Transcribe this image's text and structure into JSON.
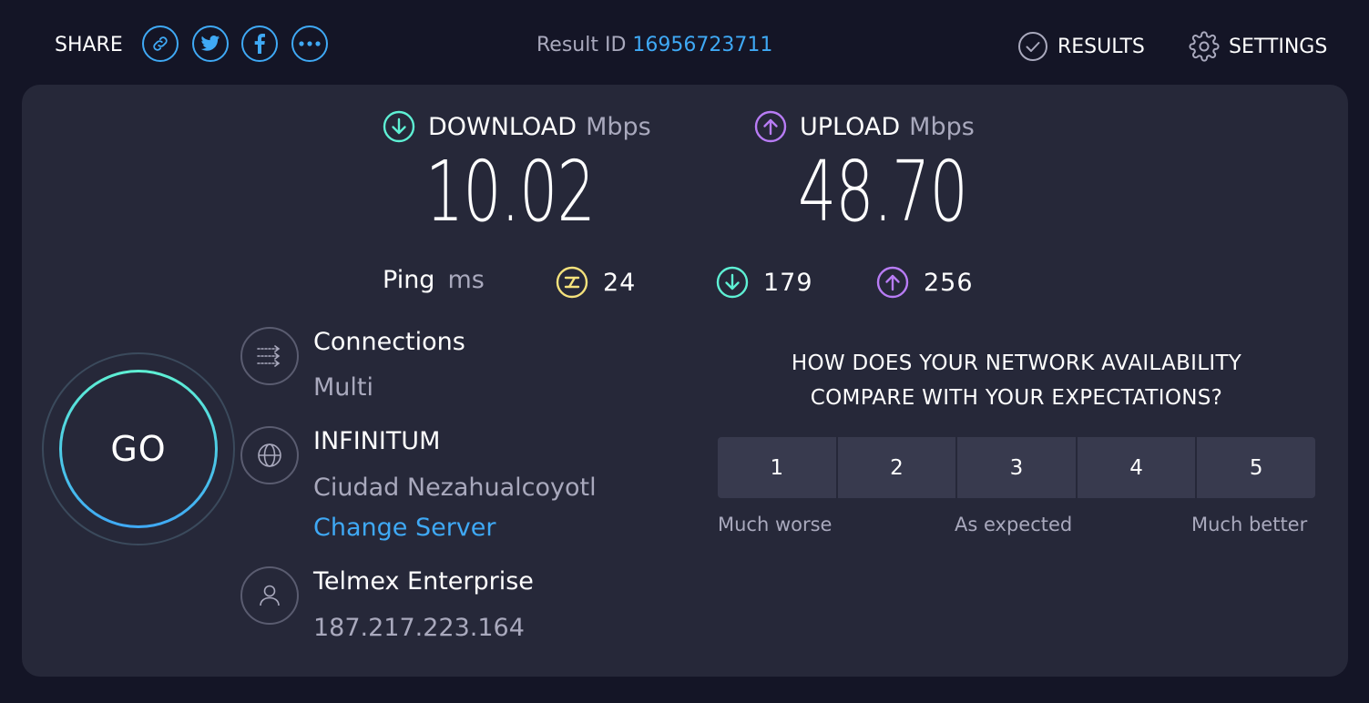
{
  "header": {
    "share_label": "SHARE",
    "share_buttons": [
      "link-icon",
      "twitter-icon",
      "facebook-icon",
      "more-icon"
    ],
    "result_id_label": "Result ID",
    "result_id_value": "16956723711",
    "results_label": "RESULTS",
    "settings_label": "SETTINGS"
  },
  "download": {
    "label": "DOWNLOAD",
    "unit": "Mbps",
    "value": "10.02",
    "color": "#5ef0d4"
  },
  "upload": {
    "label": "UPLOAD",
    "unit": "Mbps",
    "value": "48.70",
    "color": "#b87cf5"
  },
  "ping": {
    "label": "Ping",
    "unit": "ms",
    "idle": "24",
    "download": "179",
    "upload": "256",
    "idle_color": "#f5e27c"
  },
  "go_label": "GO",
  "connections": {
    "title": "Connections",
    "value": "Multi"
  },
  "server": {
    "name": "INFINITUM",
    "location": "Ciudad Nezahualcoyotl",
    "change_label": "Change Server"
  },
  "provider": {
    "name": "Telmex Enterprise",
    "ip": "187.217.223.164"
  },
  "survey": {
    "question_line1": "HOW DOES YOUR NETWORK AVAILABILITY",
    "question_line2": "COMPARE WITH YOUR EXPECTATIONS?",
    "options": [
      "1",
      "2",
      "3",
      "4",
      "5"
    ],
    "low_label": "Much worse",
    "mid_label": "As expected",
    "high_label": "Much better"
  },
  "colors": {
    "accent_blue": "#3fa9f5",
    "background": "#141526",
    "panel": "#262839"
  }
}
